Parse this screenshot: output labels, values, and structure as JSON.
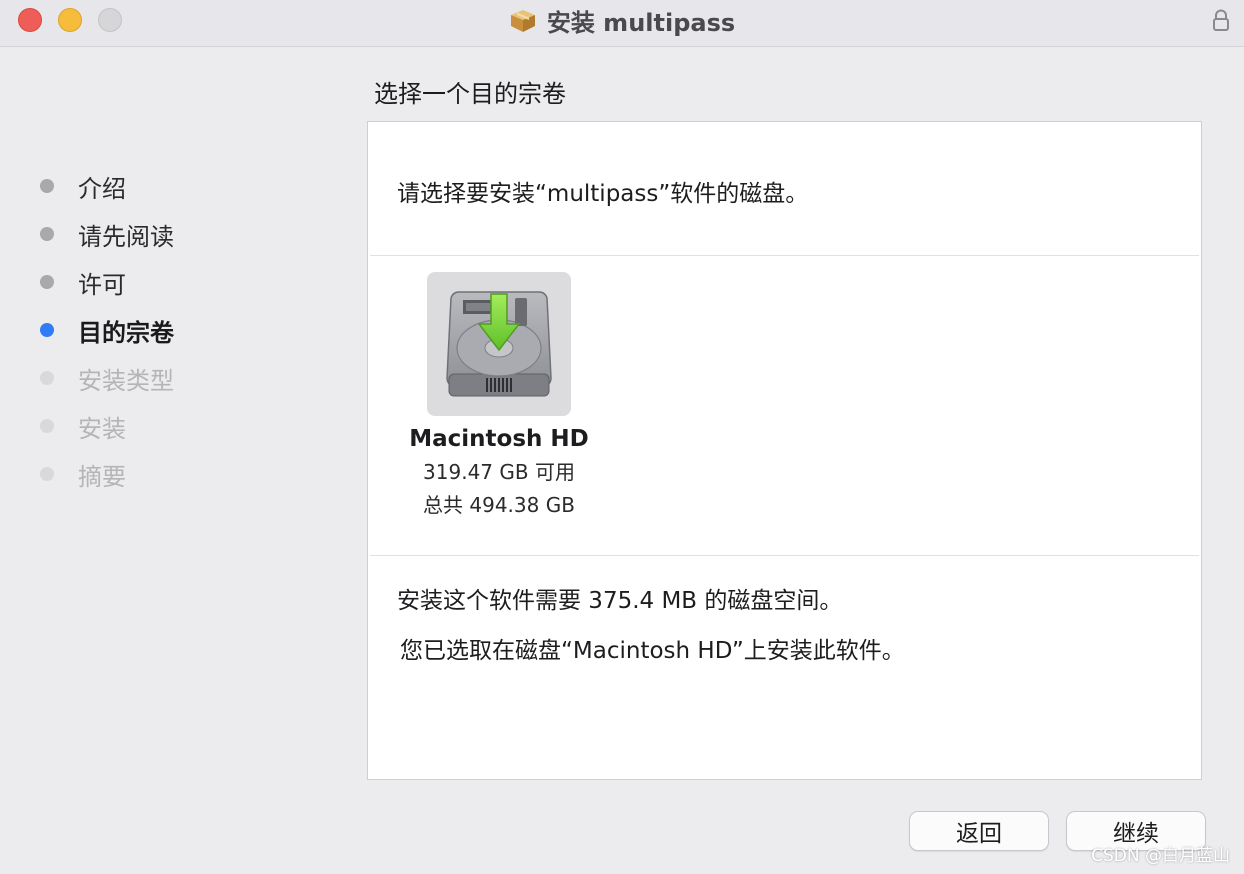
{
  "window": {
    "title": "安装 multipass"
  },
  "sidebar": {
    "steps": [
      {
        "label": "介绍",
        "state": "done"
      },
      {
        "label": "请先阅读",
        "state": "done"
      },
      {
        "label": "许可",
        "state": "done"
      },
      {
        "label": "目的宗卷",
        "state": "current"
      },
      {
        "label": "安装类型",
        "state": "future"
      },
      {
        "label": "安装",
        "state": "future"
      },
      {
        "label": "摘要",
        "state": "future"
      }
    ]
  },
  "main": {
    "heading": "选择一个目的宗卷",
    "instruction": "请选择要安装“multipass”软件的磁盘。",
    "disk": {
      "name": "Macintosh HD",
      "free": "319.47 GB 可用",
      "total": "总共 494.38 GB",
      "icon": "hard-disk-download-icon"
    },
    "info_required": "安装这个软件需要 375.4 MB 的磁盘空间。",
    "info_selected": "您已选取在磁盘“Macintosh HD”上安装此软件。"
  },
  "buttons": {
    "back": "返回",
    "continue": "继续"
  },
  "watermark": "CSDN @白月蓝山",
  "colors": {
    "accent": "#2f7cf6",
    "close": "#ee5d57",
    "minimize": "#f5bd3b",
    "download_arrow": "#7ed63e"
  }
}
